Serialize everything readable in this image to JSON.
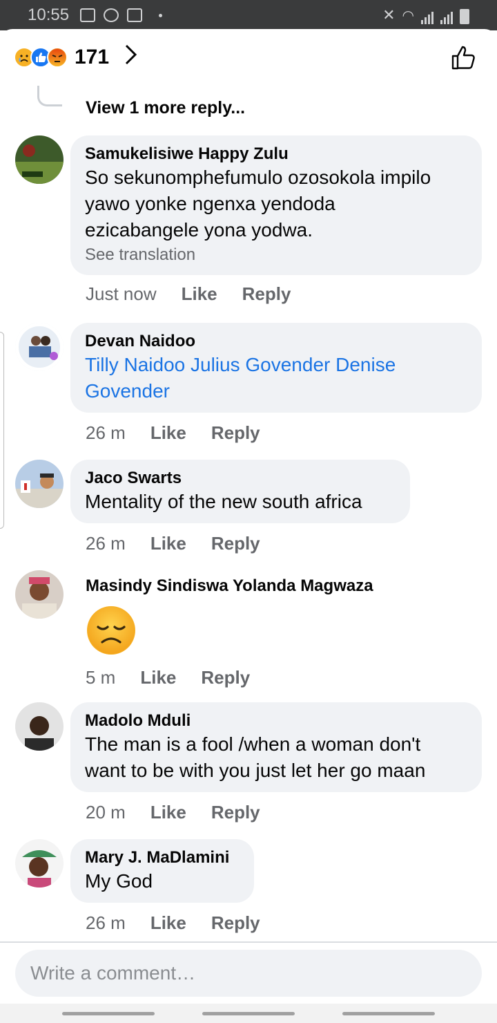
{
  "status_bar": {
    "time": "10:55"
  },
  "header": {
    "reaction_count": "171",
    "reactions": [
      "sad",
      "like",
      "angry"
    ]
  },
  "thread": {
    "view_more": "View 1 more reply..."
  },
  "comments": [
    {
      "author": "Samukelisiwe Happy Zulu",
      "lines": [
        "So sekunomphefumulo ozosokola impilo",
        "yawo yonke ngenxa yendoda",
        "ezicabangele yona yodwa."
      ],
      "see_translation": "See translation",
      "time": "Just now",
      "like": "Like",
      "reply": "Reply"
    },
    {
      "author": "Devan Naidoo",
      "lines": [
        "Tilly Naidoo Julius Govender Denise",
        "Govender"
      ],
      "time": "26 m",
      "like": "Like",
      "reply": "Reply"
    },
    {
      "author": "Jaco Swarts",
      "lines": [
        "Mentality of the new south africa"
      ],
      "time": "26 m",
      "like": "Like",
      "reply": "Reply"
    },
    {
      "author": "Masindy Sindiswa Yolanda Magwaza",
      "emoji": "disappointed-face",
      "time": "5 m",
      "like": "Like",
      "reply": "Reply"
    },
    {
      "author": "Madolo Mduli",
      "lines": [
        "The man is a fool /when a woman don't",
        "want to be with you just let her go maan"
      ],
      "time": "20 m",
      "like": "Like",
      "reply": "Reply"
    },
    {
      "author": "Mary J. MaDlamini",
      "lines": [
        "My God"
      ],
      "time": "26 m",
      "like": "Like",
      "reply": "Reply"
    }
  ],
  "composer": {
    "placeholder": "Write a comment…"
  },
  "colors": {
    "accent": "#1b74e4",
    "bubble": "#f0f2f5",
    "meta": "#65676b"
  }
}
